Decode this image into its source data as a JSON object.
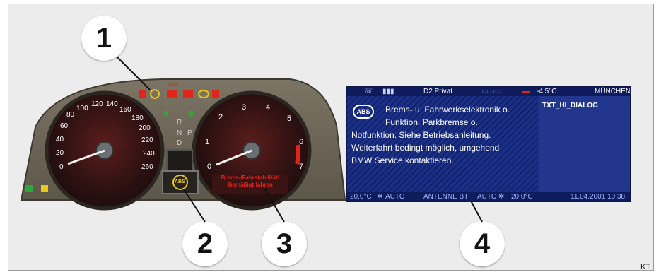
{
  "corner_code": "KT",
  "callouts": [
    "1",
    "2",
    "3",
    "4"
  ],
  "cluster": {
    "speedo_labels": [
      "0",
      "20",
      "40",
      "60",
      "80",
      "100",
      "120",
      "140",
      "160",
      "180",
      "200",
      "220",
      "240",
      "260"
    ],
    "tacho_labels": [
      "0",
      "1",
      "2",
      "3",
      "4",
      "5",
      "6",
      "7"
    ],
    "gear_labels": [
      "R",
      "N",
      "P",
      "D"
    ],
    "warning_text_line1": "Brems-/Fahrstabilität!",
    "warning_text_line2": "Gemäßigt fahren",
    "abs_label": "ABS",
    "top_abs_label": "ABS",
    "colors": {
      "red": "#e0261b",
      "yellow": "#e8c81a",
      "green": "#2ea83a"
    },
    "icons": [
      "brake-warning-icon",
      "traction-icon",
      "engine-icon",
      "coolant-icon",
      "seatbelt-icon",
      "turn-left-icon",
      "turn-right-icon",
      "fog-light-icon",
      "headlight-icon"
    ]
  },
  "cid": {
    "status": {
      "station": "D2 Privat",
      "temp": "-4,5°C",
      "city": "MÜNCHEN"
    },
    "message_line1": "Brems- u. Fahrwerkselektronik o.",
    "message_line2": "Funktion. Parkbremse o.",
    "message_line3": "Notfunktion. Siehe Betriebsanleitung.",
    "message_line4": "Weiterfahrt bedingt möglich, umgehend",
    "message_line5": "BMW Service kontaktieren.",
    "abs_icon_label": "ABS",
    "dialog_label": "TXT_HI_DIALOG",
    "bottom": {
      "temp_left": "20,0°C",
      "auto_left": "AUTO",
      "antenna": "ANTENNE BT",
      "auto_right": "AUTO",
      "temp_right": "20,0°C",
      "datetime": "11.04.2001 10:38"
    }
  }
}
